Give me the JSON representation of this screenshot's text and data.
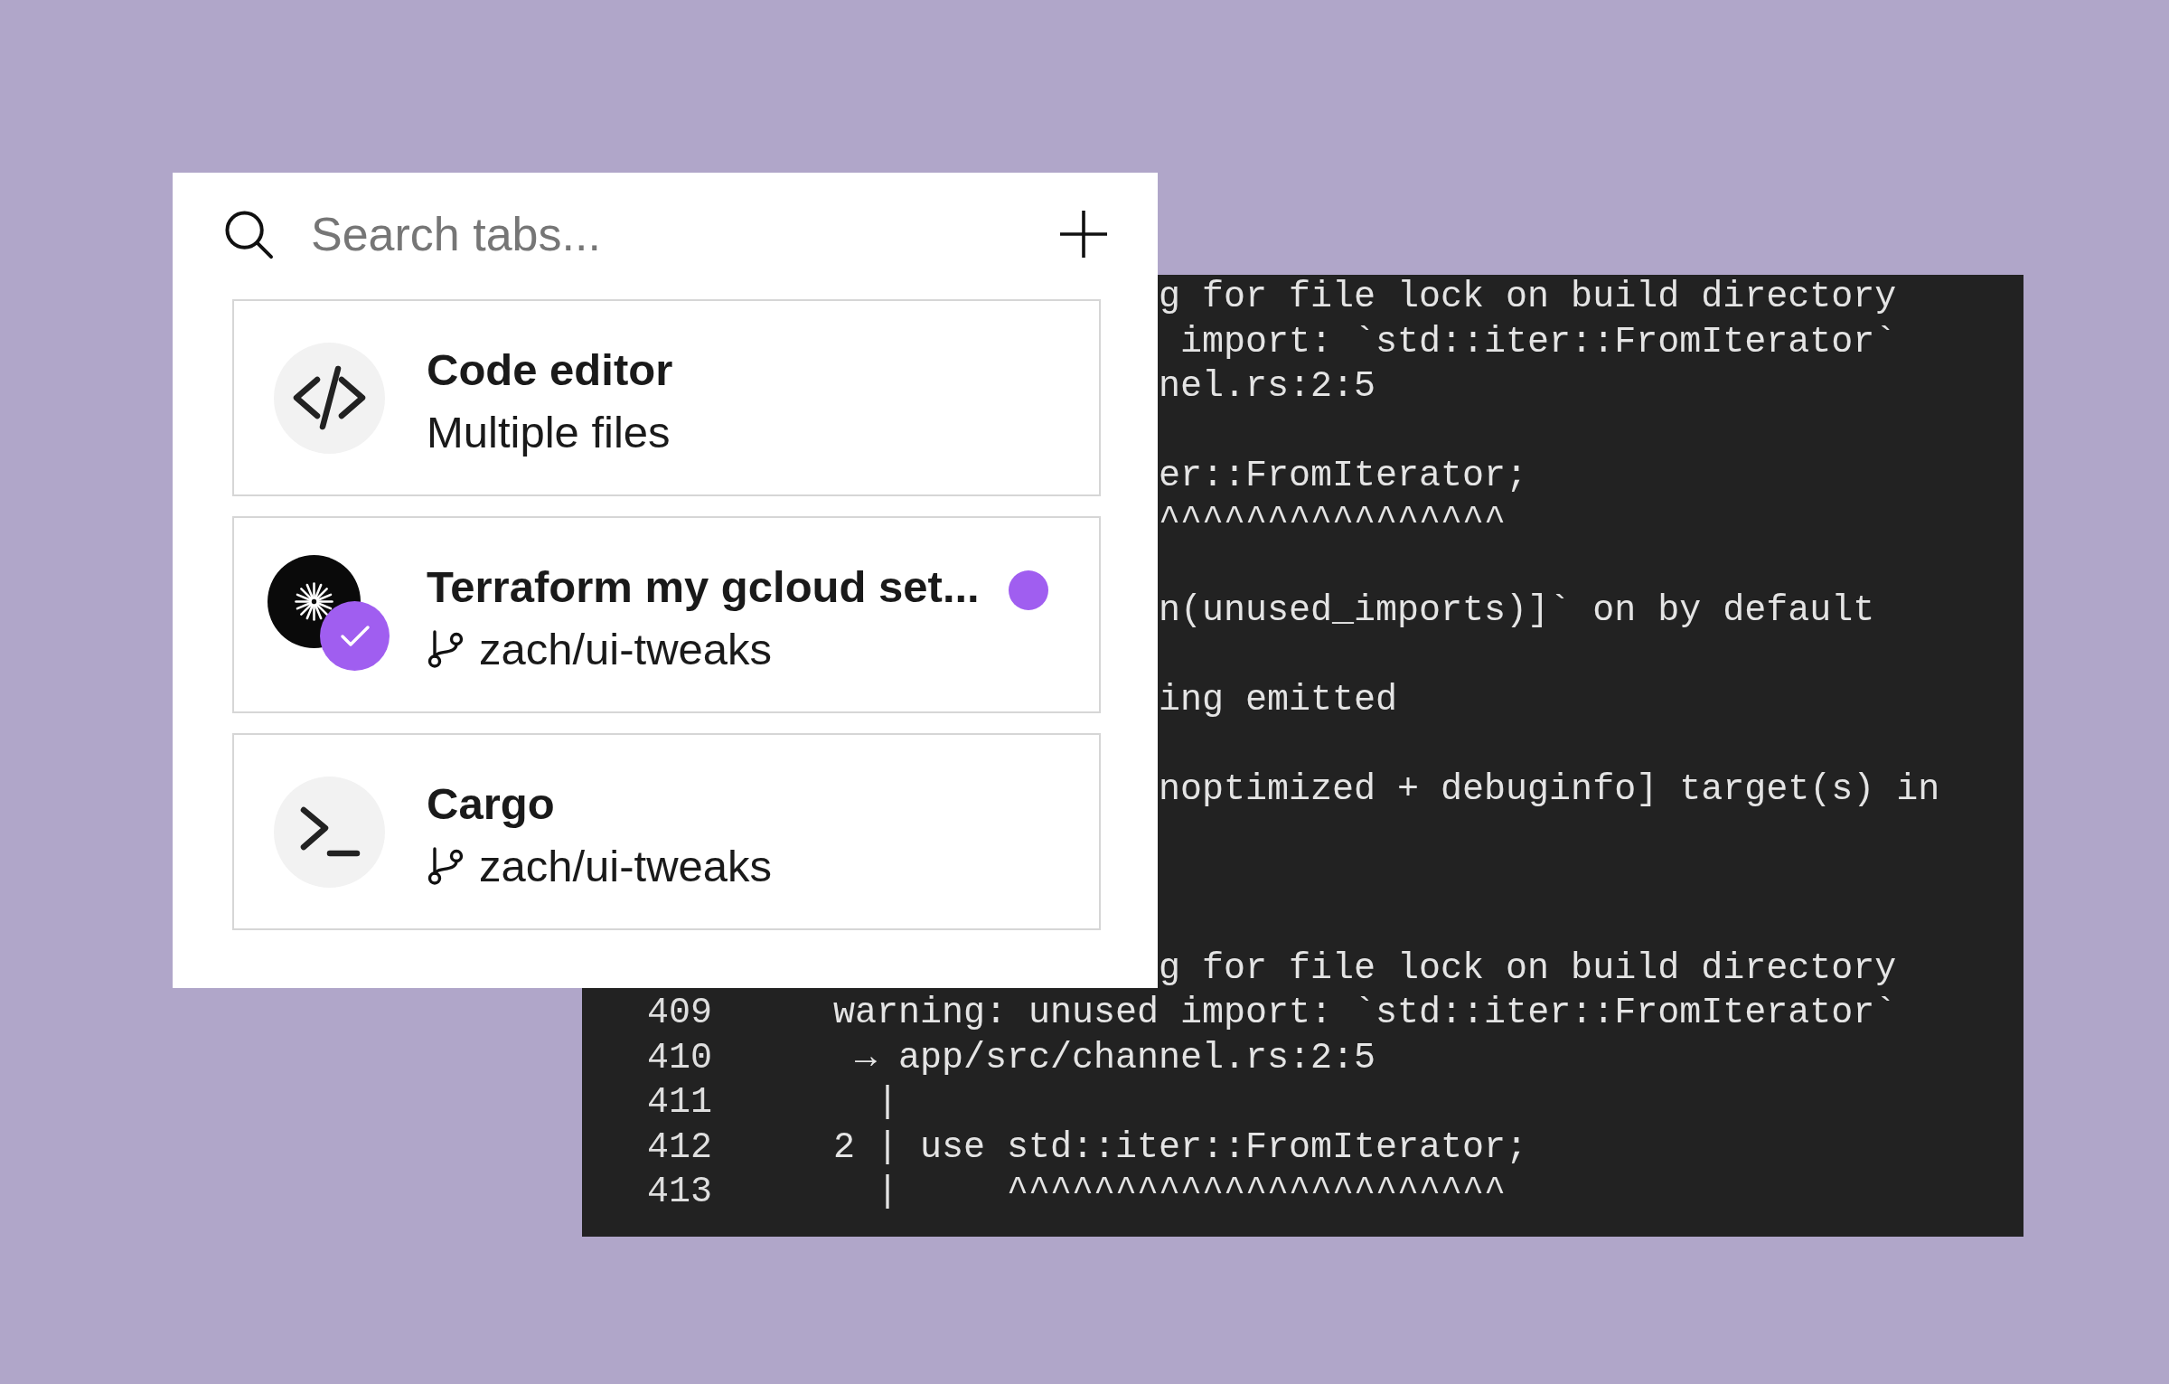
{
  "tab_switcher": {
    "search": {
      "placeholder": "Search tabs..."
    },
    "tabs": [
      {
        "kind": "editor",
        "title": "Code editor",
        "subtitle": "Multiple files",
        "completed": false,
        "unread": false
      },
      {
        "kind": "agent",
        "title": "Terraform my gcloud set...",
        "branch": "zach/ui-tweaks",
        "completed": true,
        "unread": true
      },
      {
        "kind": "terminal",
        "title": "Cargo",
        "branch": "zach/ui-tweaks",
        "completed": false,
        "unread": false
      }
    ]
  },
  "terminal": {
    "lines": [
      {
        "kind": "covered",
        "text": "g for file lock on build directory"
      },
      {
        "kind": "covered",
        "text": " import: `std::iter::FromIterator`"
      },
      {
        "kind": "covered",
        "text": "nel.rs:2:5"
      },
      {
        "kind": "blank"
      },
      {
        "kind": "covered",
        "text": "er::FromIterator;"
      },
      {
        "kind": "covered",
        "text": "^^^^^^^^^^^^^^^^"
      },
      {
        "kind": "blank"
      },
      {
        "kind": "covered",
        "text": "n(unused_imports)]` on by default"
      },
      {
        "kind": "blank"
      },
      {
        "kind": "covered",
        "text": "ing emitted"
      },
      {
        "kind": "blank"
      },
      {
        "kind": "covered",
        "text": "noptimized + debuginfo] target(s) in"
      },
      {
        "kind": "blank"
      },
      {
        "kind": "blank"
      },
      {
        "kind": "blank"
      },
      {
        "kind": "covered",
        "text": "g for file lock on build directory"
      },
      {
        "kind": "numbered",
        "number": "409",
        "text": "warning: unused import: `std::iter::FromIterator`"
      },
      {
        "kind": "numbered",
        "number": "410",
        "text": " → app/src/channel.rs:2:5"
      },
      {
        "kind": "numbered",
        "number": "411",
        "text": "  |"
      },
      {
        "kind": "numbered",
        "number": "412",
        "text": "2 | use std::iter::FromIterator;"
      },
      {
        "kind": "numbered",
        "number": "413",
        "text": "  |     ^^^^^^^^^^^^^^^^^^^^^^^"
      }
    ]
  }
}
